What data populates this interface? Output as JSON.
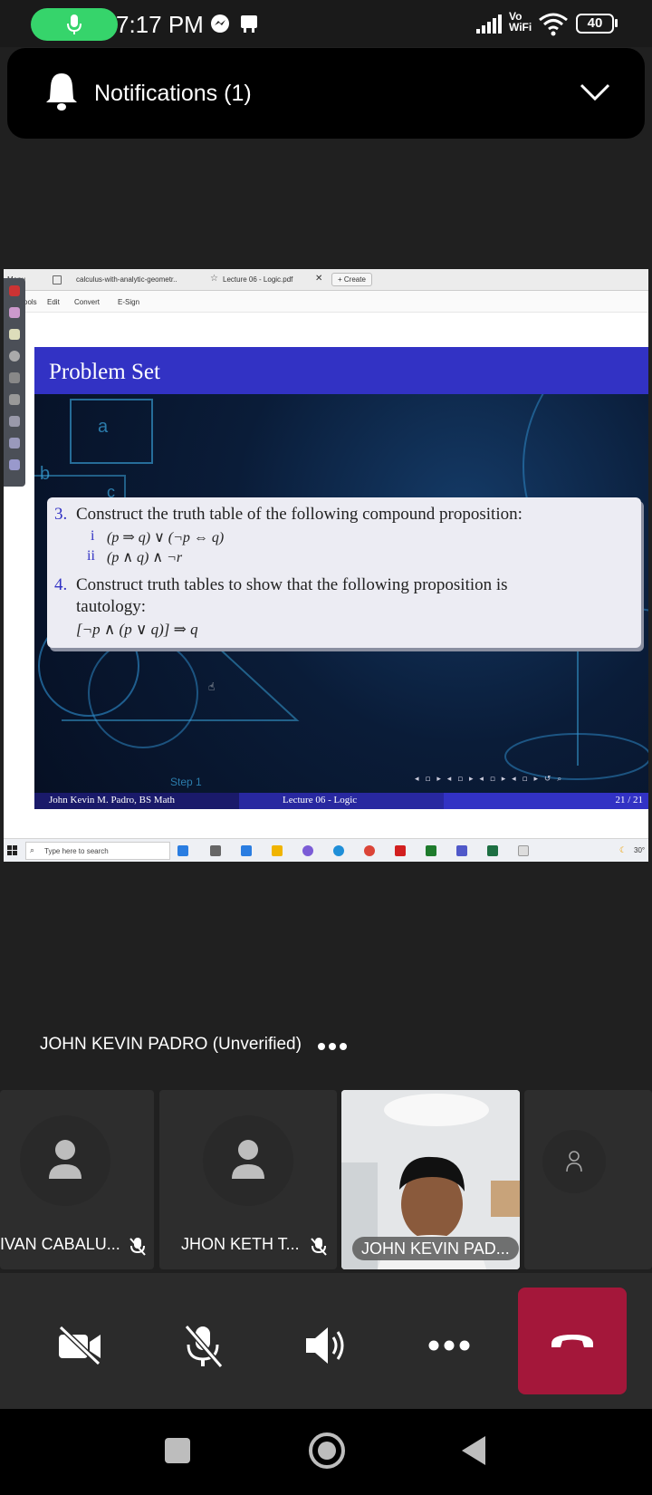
{
  "status_bar": {
    "time": "7:17 PM",
    "network": "Vo WiFi",
    "battery": "40"
  },
  "notifications": {
    "label": "Notifications (1)"
  },
  "shared_screen": {
    "browser_tabs": [
      {
        "label": "Menu"
      },
      {
        "label": "calculus-with-analytic-geometr.."
      },
      {
        "label": "Lecture 06 - Logic.pdf"
      },
      {
        "label": "+ Create"
      }
    ],
    "menu_items": [
      "Tools",
      "Edit",
      "Convert",
      "E-Sign"
    ],
    "slide": {
      "title": "Problem Set",
      "q3_number": "3.",
      "q3_text": "Construct the truth table of the following compound proposition:",
      "q3_i_label": "i",
      "q3_i_formula": "(p ⇒ q) ∨ (¬p ⇔ q)",
      "q3_ii_label": "ii",
      "q3_ii_formula": "(p ∧ q) ∧ ¬r",
      "q4_number": "4.",
      "q4_text": "Construct truth tables to show that the following proposition is",
      "q4_text2": "tautology:",
      "q4_formula": "[¬p ∧ (p ∨ q)] ⇒ q",
      "bg_letter_a": "a",
      "bg_letter_b": "b",
      "bg_letter_c": "c",
      "bg_step": "Step 1",
      "footer_author": "John Kevin M. Padro, BS Math",
      "footer_lecture": "Lecture 06 - Logic",
      "footer_page": "21 / 21"
    },
    "taskbar": {
      "search_placeholder": "Type here to search",
      "temperature": "30°"
    }
  },
  "speaker": {
    "name": "JOHN KEVIN PADRO (Unverified)"
  },
  "participants": [
    {
      "name": "IVAN CABALU..."
    },
    {
      "name": "JHON KETH T..."
    },
    {
      "name": "JOHN KEVIN PAD..."
    }
  ],
  "colors": {
    "mic_active": "#36d46b",
    "end_call": "#a4173a",
    "slide_header": "#3232c4"
  }
}
